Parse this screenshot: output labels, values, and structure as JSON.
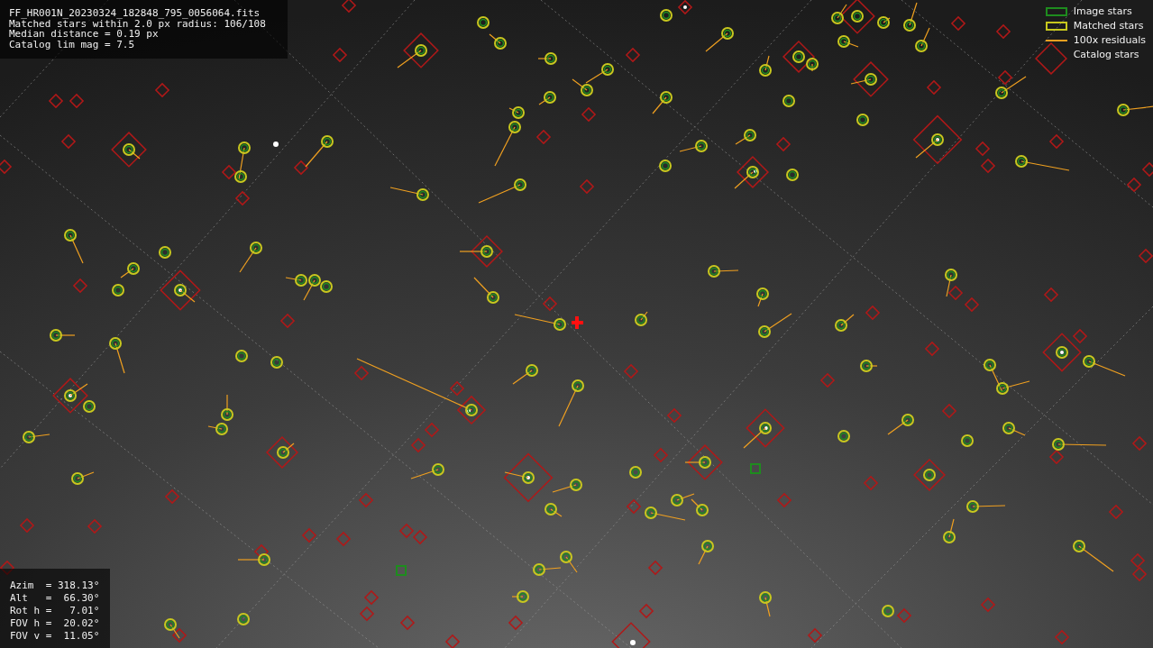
{
  "info_panel": {
    "lines": [
      "FF_HR001N_20230324_182848_795_0056064.fits",
      "Matched stars within 2.0 px radius: 106/108",
      "Median distance = 0.19 px",
      "Catalog lim mag = 7.5"
    ]
  },
  "legend": [
    {
      "label": "Image stars",
      "kind": "box",
      "color": "#1e8c1e"
    },
    {
      "label": "Matched stars",
      "kind": "box",
      "color": "#c8c81e"
    },
    {
      "label": "100x residuals",
      "kind": "line",
      "color": "#f0a020"
    },
    {
      "label": "Catalog stars",
      "kind": "none"
    }
  ],
  "pointing_panel": {
    "lines": [
      "Azim  = 318.13°",
      "Alt   =  66.30°",
      "Rot h =   7.01°",
      "FOV h =  20.02°",
      "FOV v =  11.05°"
    ]
  }
}
